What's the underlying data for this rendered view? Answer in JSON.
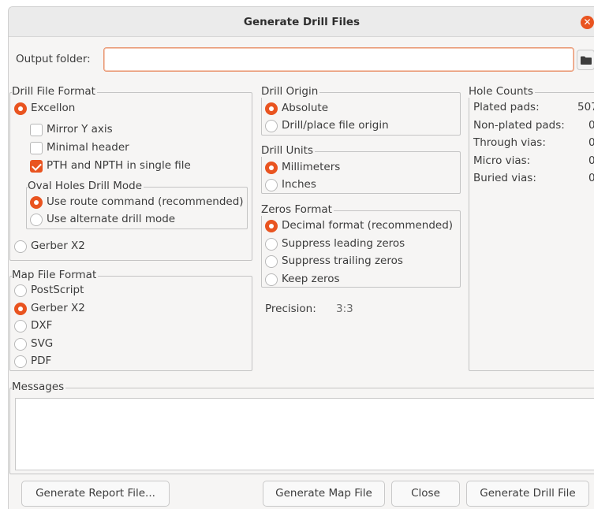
{
  "window": {
    "title": "Generate Drill Files"
  },
  "output_folder": {
    "label": "Output folder:",
    "value": "",
    "browse_icon": "folder-icon"
  },
  "drill_file_format": {
    "legend": "Drill File Format",
    "excellon": "Excellon",
    "mirror_y": "Mirror Y axis",
    "minimal_header": "Minimal header",
    "pth_npth_single": "PTH and NPTH in single file",
    "oval_holes_legend": "Oval Holes Drill Mode",
    "use_route": "Use route command (recommended)",
    "use_alternate": "Use alternate drill mode",
    "gerber_x2": "Gerber X2"
  },
  "map_file_format": {
    "legend": "Map File Format",
    "options": [
      "PostScript",
      "Gerber X2",
      "DXF",
      "SVG",
      "PDF"
    ],
    "selected": "Gerber X2"
  },
  "drill_origin": {
    "legend": "Drill Origin",
    "absolute": "Absolute",
    "drill_place": "Drill/place file origin"
  },
  "drill_units": {
    "legend": "Drill Units",
    "millimeters": "Millimeters",
    "inches": "Inches"
  },
  "zeros_format": {
    "legend": "Zeros Format",
    "decimal": "Decimal format (recommended)",
    "suppress_leading": "Suppress leading zeros",
    "suppress_trailing": "Suppress trailing zeros",
    "keep": "Keep zeros"
  },
  "precision": {
    "label": "Precision:",
    "value": "3:3"
  },
  "hole_counts": {
    "legend": "Hole Counts",
    "rows": [
      {
        "label": "Plated pads:",
        "value": "507"
      },
      {
        "label": "Non-plated pads:",
        "value": "0"
      },
      {
        "label": "Through vias:",
        "value": "0"
      },
      {
        "label": "Micro vias:",
        "value": "0"
      },
      {
        "label": "Buried vias:",
        "value": "0"
      }
    ]
  },
  "messages": {
    "legend": "Messages"
  },
  "buttons": {
    "report": "Generate Report File...",
    "map": "Generate Map File",
    "close": "Close",
    "drill": "Generate Drill File"
  },
  "colors": {
    "accent": "#e95420",
    "background": "#f6f5f4"
  }
}
